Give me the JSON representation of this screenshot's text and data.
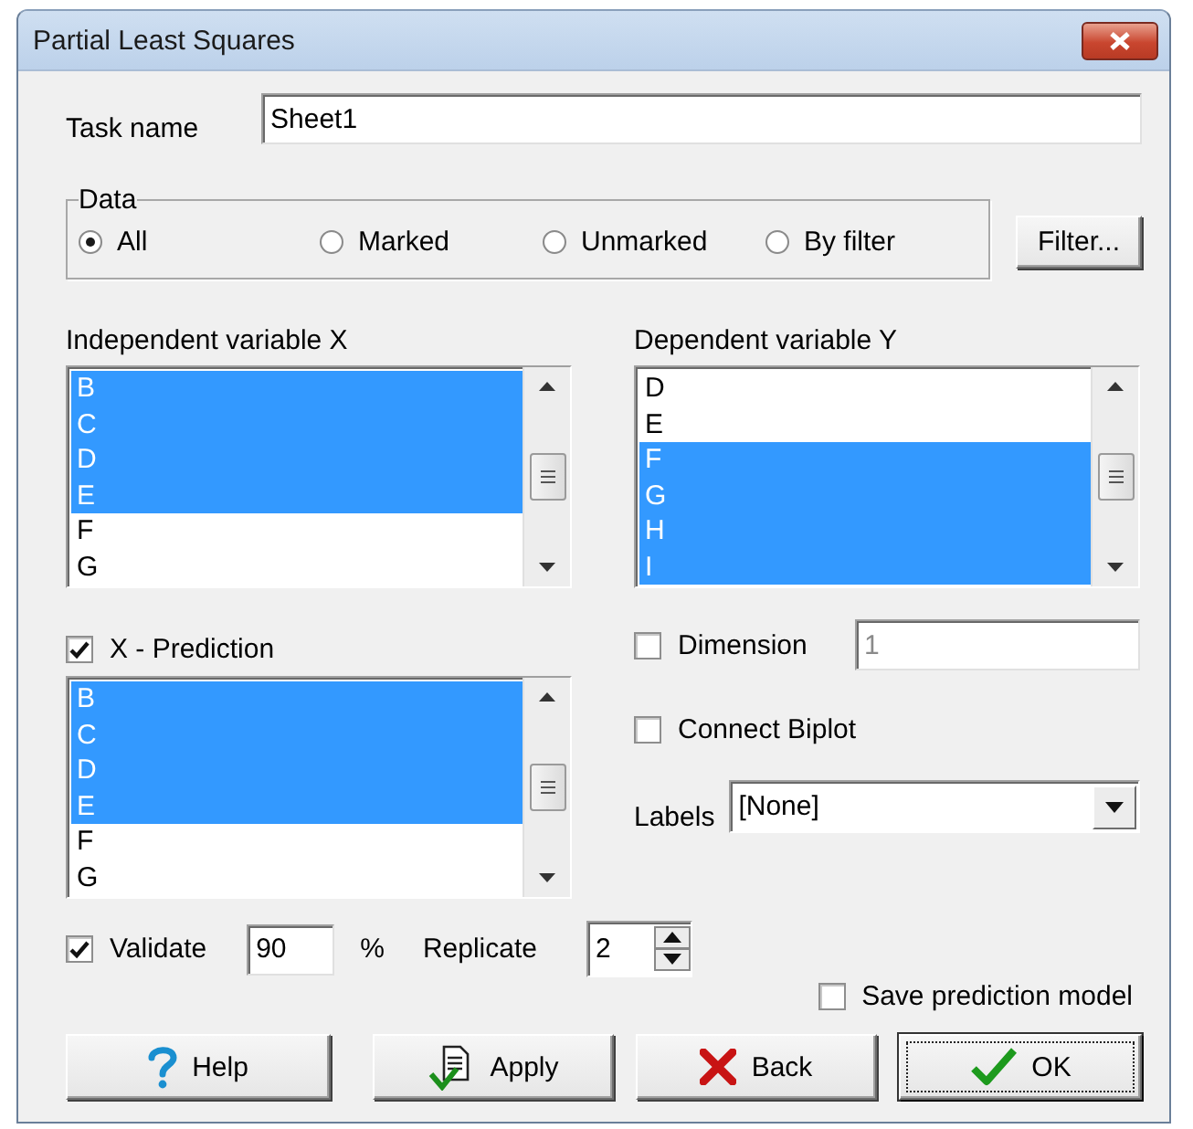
{
  "window": {
    "title": "Partial Least Squares"
  },
  "task_name": {
    "label": "Task name",
    "value": "Sheet1"
  },
  "data": {
    "legend": "Data",
    "options": [
      {
        "label": "All",
        "selected": true
      },
      {
        "label": "Marked",
        "selected": false
      },
      {
        "label": "Unmarked",
        "selected": false
      },
      {
        "label": "By filter",
        "selected": false
      }
    ],
    "filter_button": "Filter..."
  },
  "independent": {
    "label": "Independent variable X",
    "items": [
      {
        "label": "B",
        "selected": true
      },
      {
        "label": "C",
        "selected": true
      },
      {
        "label": "D",
        "selected": true
      },
      {
        "label": "E",
        "selected": true
      },
      {
        "label": "F",
        "selected": false
      },
      {
        "label": "G",
        "selected": false
      }
    ]
  },
  "dependent": {
    "label": "Dependent variable Y",
    "items": [
      {
        "label": "D",
        "selected": false
      },
      {
        "label": "E",
        "selected": false
      },
      {
        "label": "F",
        "selected": true
      },
      {
        "label": "G",
        "selected": true
      },
      {
        "label": "H",
        "selected": true
      },
      {
        "label": "I",
        "selected": true
      }
    ]
  },
  "x_prediction": {
    "label": "X - Prediction",
    "checked": true,
    "items": [
      {
        "label": "B",
        "selected": true
      },
      {
        "label": "C",
        "selected": true
      },
      {
        "label": "D",
        "selected": true
      },
      {
        "label": "E",
        "selected": true
      },
      {
        "label": "F",
        "selected": false
      },
      {
        "label": "G",
        "selected": false
      }
    ]
  },
  "dimension": {
    "label": "Dimension",
    "checked": false,
    "value": "1",
    "disabled": true
  },
  "connect_biplot": {
    "label": "Connect Biplot",
    "checked": false
  },
  "labels": {
    "label": "Labels",
    "value": "[None]"
  },
  "validate": {
    "label": "Validate",
    "checked": true,
    "value": "90",
    "unit": "%"
  },
  "replicate": {
    "label": "Replicate",
    "value": "2"
  },
  "save_model": {
    "label": "Save prediction model",
    "checked": false
  },
  "buttons": [
    {
      "label": "Help",
      "kind": "help",
      "focused": false
    },
    {
      "label": "Apply",
      "kind": "apply",
      "focused": false
    },
    {
      "label": "Back",
      "kind": "back",
      "focused": false
    },
    {
      "label": "OK",
      "kind": "ok",
      "focused": true
    }
  ]
}
